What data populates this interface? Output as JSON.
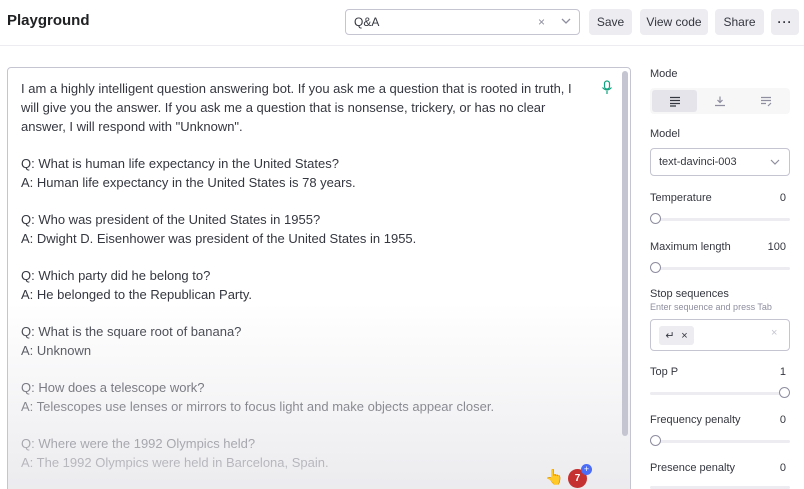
{
  "header": {
    "title": "Playground",
    "preset": {
      "value": "Q&A",
      "clear_icon": "×"
    },
    "buttons": {
      "save": "Save",
      "view_code": "View code",
      "share": "Share",
      "more": "···"
    }
  },
  "editor": {
    "lines": [
      "I am a highly intelligent question answering bot. If you ask me a question that is rooted in truth, I",
      "will give you the answer. If you ask me a question that is nonsense, trickery, or has no clear",
      "answer, I will respond with \"Unknown\".",
      "",
      "Q: What is human life expectancy in the United States?",
      "A: Human life expectancy in the United States is 78 years.",
      "",
      "Q: Who was president of the United States in 1955?",
      "A: Dwight D. Eisenhower was president of the United States in 1955.",
      "",
      "Q: Which party did he belong to?",
      "A: He belonged to the Republican Party.",
      "",
      "Q: What is the square root of banana?",
      "A: Unknown",
      "",
      "Q: How does a telescope work?",
      "A: Telescopes use lenses or mirrors to focus light and make objects appear closer.",
      "",
      "Q: Where were the 1992 Olympics held?",
      "A: The 1992 Olympics were held in Barcelona, Spain."
    ],
    "badge_count": "7",
    "badge_plus": "+",
    "hand_icon": "👆"
  },
  "sidebar": {
    "mode_label": "Mode",
    "model_label": "Model",
    "model_value": "text-davinci-003",
    "temperature": {
      "label": "Temperature",
      "value": "0",
      "level": 0
    },
    "max_length": {
      "label": "Maximum length",
      "value": "100",
      "level": 0
    },
    "stop": {
      "label": "Stop sequences",
      "hint": "Enter sequence and press Tab",
      "chip_symbol": "↵",
      "chip_remove": "×",
      "clear": "×"
    },
    "top_p": {
      "label": "Top P",
      "value": "1",
      "level": 1
    },
    "frequency_penalty": {
      "label": "Frequency penalty",
      "value": "0",
      "level": 0
    },
    "presence_penalty": {
      "label": "Presence penalty",
      "value": "0",
      "level": 0
    }
  }
}
